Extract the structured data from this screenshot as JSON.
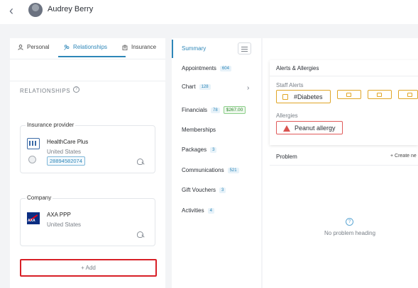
{
  "header": {
    "patient_name": "Audrey Berry"
  },
  "tabs": [
    {
      "label": "Personal",
      "icon": "person-icon"
    },
    {
      "label": "Relationships",
      "icon": "relationships-icon"
    },
    {
      "label": "Insurance",
      "icon": "building-icon"
    }
  ],
  "relationships": {
    "section_title": "RELATIONSHIPS",
    "cards": [
      {
        "legend": "Insurance provider",
        "name": "HealthCare Plus",
        "country": "United States",
        "policy": "28894582074"
      },
      {
        "legend": "Company",
        "name": "AXA PPP",
        "country": "United States"
      }
    ],
    "add_label": "Add"
  },
  "nav": [
    {
      "label": "Summary"
    },
    {
      "label": "Appointments",
      "badge": "604"
    },
    {
      "label": "Chart",
      "badge": "128"
    },
    {
      "label": "Financials",
      "badge": "78",
      "amount": "$267.00"
    },
    {
      "label": "Memberships"
    },
    {
      "label": "Packages",
      "badge": "3"
    },
    {
      "label": "Communications",
      "badge": "521"
    },
    {
      "label": "Gift Vouchers",
      "badge": "3"
    },
    {
      "label": "Activities",
      "badge": "4"
    }
  ],
  "alerts": {
    "title": "Alerts & Allergies",
    "staff_label": "Staff Alerts",
    "staff_alert": "#Diabetes",
    "allergies_label": "Allergies",
    "allergy": "Peanut allergy"
  },
  "problem": {
    "label": "Problem",
    "create_label": "+ Create ne",
    "empty_text": "No problem heading"
  },
  "colors": {
    "accent": "#2d86b8",
    "warning": "#e0a526",
    "danger": "#d9534f",
    "highlight": "#d81f26"
  }
}
